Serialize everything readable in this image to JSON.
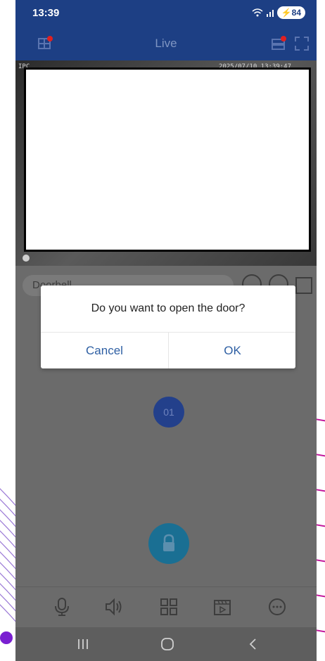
{
  "status": {
    "time": "13:39",
    "battery": "84"
  },
  "appbar": {
    "title": "Live"
  },
  "video": {
    "label": "IPC",
    "timestamp": "2025/07/10 13:39:47"
  },
  "channel": {
    "name": "Doorbell"
  },
  "channel_badge": "01",
  "dialog": {
    "message": "Do you want to open the door?",
    "cancel_label": "Cancel",
    "ok_label": "OK"
  },
  "icons": {
    "appbar_left": "device-list-icon",
    "appbar_right": [
      "recorder-icon",
      "fullscreen-icon"
    ],
    "toolbar": [
      "microphone-icon",
      "speaker-icon",
      "grid-layout-icon",
      "playback-icon",
      "more-icon"
    ],
    "navbar": [
      "recents-icon",
      "home-icon",
      "back-icon"
    ]
  },
  "colors": {
    "brand": "#1d3f84",
    "accent": "#2e5fa3",
    "unlock": "#1a6f93",
    "status_dot": "#e02020"
  }
}
